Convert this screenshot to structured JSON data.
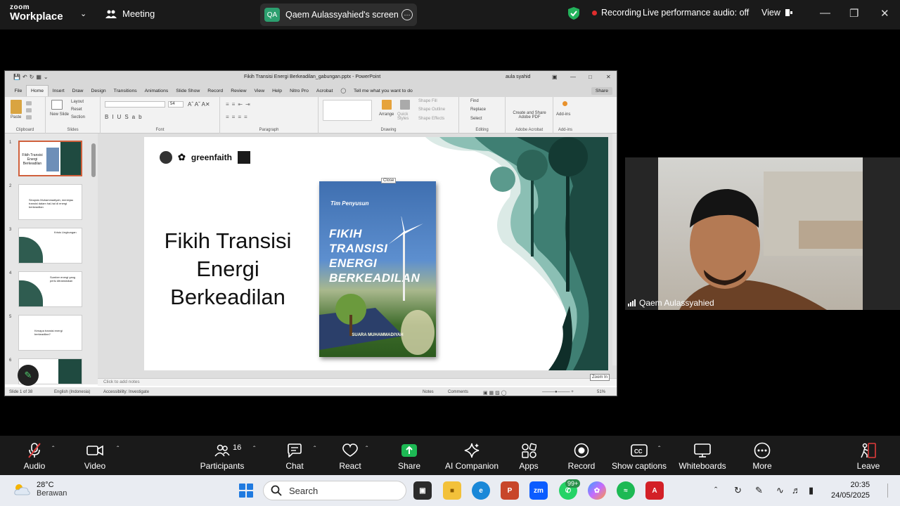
{
  "zoom": {
    "brand_line1": "zoom",
    "brand_line2": "Workplace",
    "meeting_label": "Meeting",
    "screen_initials": "QA",
    "screen_label": "Qaem Aulassyahied's screen",
    "recording_label": "Recording",
    "audio_status": "Live performance audio: off",
    "view_label": "View",
    "participant_name": "Qaem Aulassyahied",
    "toolbar": [
      {
        "label": "Audio",
        "icon": "mic-muted-icon"
      },
      {
        "label": "Video",
        "icon": "video-icon"
      },
      {
        "label": "Participants",
        "icon": "participants-icon",
        "count": "16"
      },
      {
        "label": "Chat",
        "icon": "chat-icon"
      },
      {
        "label": "React",
        "icon": "heart-icon"
      },
      {
        "label": "Share",
        "icon": "share-icon"
      },
      {
        "label": "AI Companion",
        "icon": "sparkle-icon"
      },
      {
        "label": "Apps",
        "icon": "apps-icon"
      },
      {
        "label": "Record",
        "icon": "record-icon"
      },
      {
        "label": "Show captions",
        "icon": "cc-icon"
      },
      {
        "label": "Whiteboards",
        "icon": "whiteboard-icon"
      },
      {
        "label": "More",
        "icon": "more-icon"
      },
      {
        "label": "Leave",
        "icon": "leave-icon"
      }
    ]
  },
  "ppt": {
    "window_title": "Fikih Transisi Energi Berkeadilan_gabungan.pptx - PowerPoint",
    "user": "aula syahid",
    "tabs": [
      "File",
      "Home",
      "Insert",
      "Draw",
      "Design",
      "Transitions",
      "Animations",
      "Slide Show",
      "Record",
      "Review",
      "View",
      "Help",
      "Nitro Pro",
      "Acrobat"
    ],
    "tell_me": "Tell me what you want to do",
    "share": "Share",
    "ribbon": {
      "paste": "Paste",
      "clipboard": "Clipboard",
      "new_slide": "New Slide",
      "layout": "Layout",
      "reset": "Reset",
      "section": "Section",
      "slides": "Slides",
      "font_size": "54",
      "font": "Font",
      "paragraph": "Paragraph",
      "arrange": "Arrange",
      "quick_styles": "Quick Styles",
      "shape_fill": "Shape Fill",
      "shape_outline": "Shape Outline",
      "shape_effects": "Shape Effects",
      "drawing": "Drawing",
      "find": "Find",
      "replace": "Replace",
      "select": "Select",
      "editing": "Editing",
      "create_pdf": "Create and Share Adobe PDF",
      "adobe_acrobat": "Adobe Acrobat",
      "addins": "Add-ins"
    },
    "thumbnails": [
      {
        "num": "1",
        "text": "Fikih Transisi Energi Berkeadilan"
      },
      {
        "num": "2",
        "text": "Sinopsis Muhammadiyah, meninjau transisi dalam hal-hal di energi berkeadilan"
      },
      {
        "num": "3",
        "text": "Krisis Lingkungan"
      },
      {
        "num": "4",
        "text": "Sumber energi yang perlu ditransisikan"
      },
      {
        "num": "5",
        "text": "Kenapa transisi energi berkeadilan?"
      },
      {
        "num": "6",
        "text": ""
      }
    ],
    "slide": {
      "logo_text": "greenfaith",
      "title": "Fikih Transisi Energi Berkeadilan",
      "close_tag": "Close",
      "book_author": "Tim Penyusun",
      "book_title": "FIKIH TRANSISI ENERGI BERKEADILAN",
      "book_publisher": "SUARA MUHAMMADIYAH"
    },
    "notes_placeholder": "Click to add notes",
    "status": {
      "slide_of": "Slide 1 of 38",
      "language": "English (Indonesia)",
      "accessibility": "Accessibility: Investigate",
      "notes": "Notes",
      "comments": "Comments",
      "zoom": "51%",
      "zoom_in": "Zoom In"
    }
  },
  "taskbar": {
    "temp": "28°C",
    "weather": "Berawan",
    "search_placeholder": "Search",
    "whatsapp_badge": "99+",
    "time": "20:35",
    "date": "24/05/2025"
  }
}
